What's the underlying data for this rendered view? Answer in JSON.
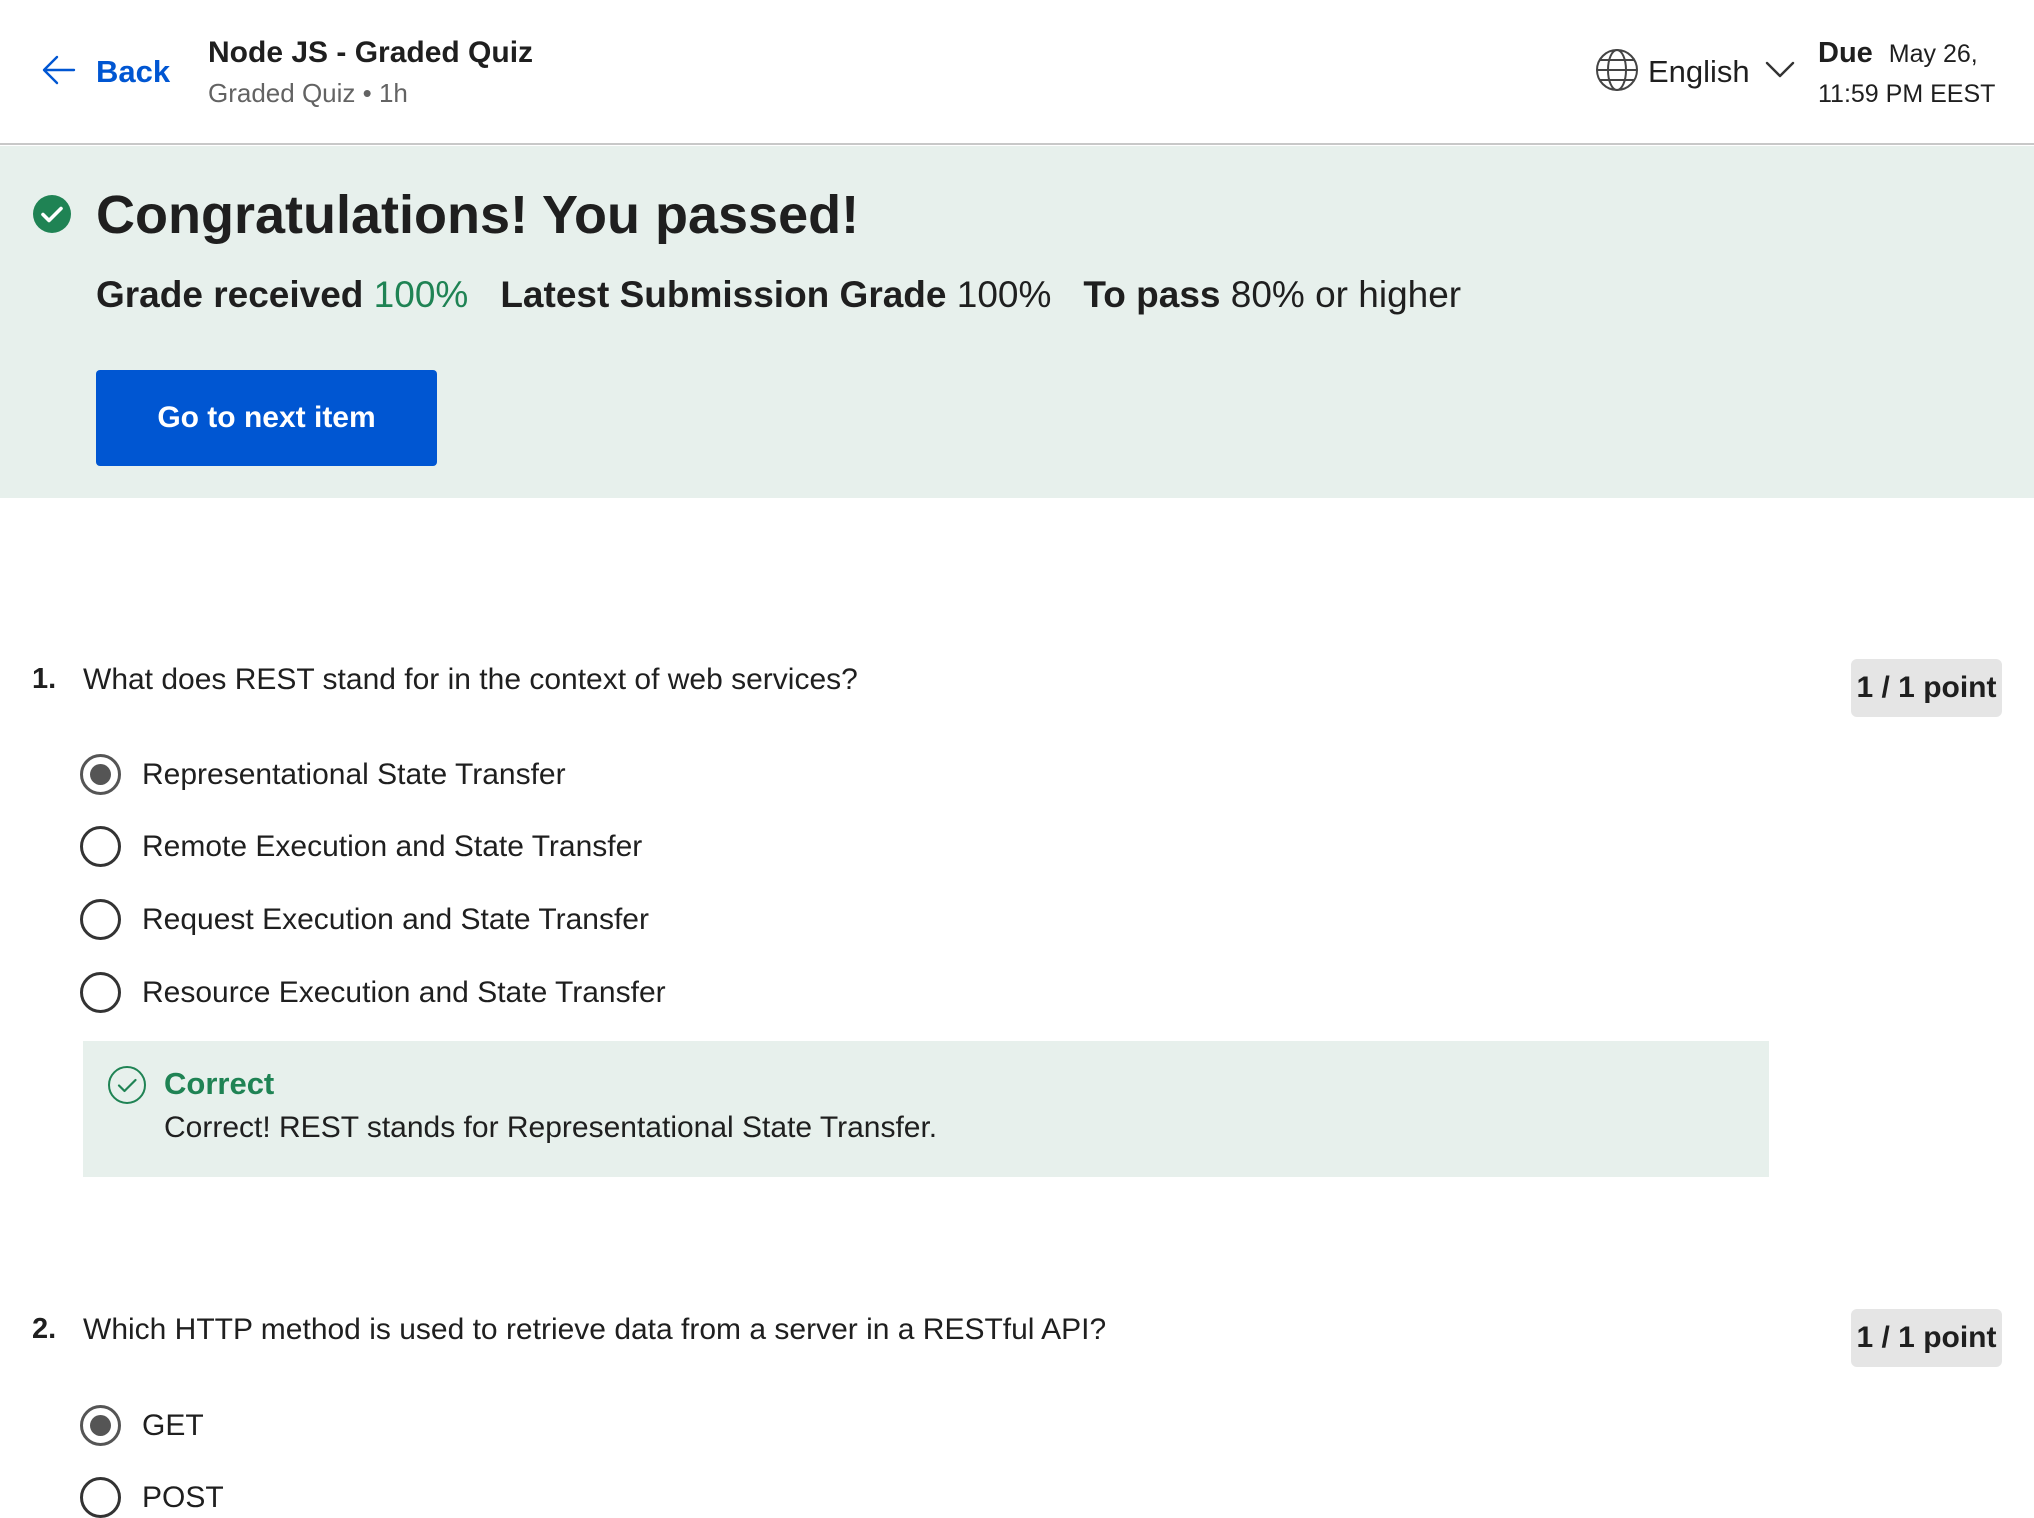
{
  "header": {
    "back_label": "Back",
    "quiz_title": "Node JS - Graded Quiz",
    "quiz_subtitle": "Graded Quiz • 1h",
    "language": "English",
    "due_label": "Due",
    "due_date": "May 26,",
    "due_time": "11:59 PM EEST"
  },
  "banner": {
    "title": "Congratulations! You passed!",
    "grade_received_label": "Grade received",
    "grade_received_value": "100%",
    "latest_label": "Latest Submission Grade",
    "latest_value": "100%",
    "to_pass_label": "To pass",
    "to_pass_value": "80% or higher",
    "next_button": "Go to next item",
    "status_color": "#1f8354",
    "accent_color": "#0056d2"
  },
  "questions": [
    {
      "number": "1.",
      "text": "What does REST stand for in the context of web services?",
      "points": "1 / 1 point",
      "options": [
        {
          "label": "Representational State Transfer",
          "selected": true
        },
        {
          "label": "Remote Execution and State Transfer",
          "selected": false
        },
        {
          "label": "Request Execution and State Transfer",
          "selected": false
        },
        {
          "label": "Resource Execution and State Transfer",
          "selected": false
        }
      ],
      "feedback": {
        "title": "Correct",
        "text": "Correct! REST stands for Representational State Transfer."
      }
    },
    {
      "number": "2.",
      "text": "Which HTTP method is used to retrieve data from a server in a RESTful API?",
      "points": "1 / 1 point",
      "options": [
        {
          "label": "GET",
          "selected": true
        },
        {
          "label": "POST",
          "selected": false
        }
      ]
    }
  ],
  "icons": {
    "back": "arrow-left-icon",
    "language": "globe-icon",
    "language_dropdown": "chevron-down-icon",
    "passed": "check-circle-filled-icon",
    "feedback": "check-circle-outline-icon"
  }
}
